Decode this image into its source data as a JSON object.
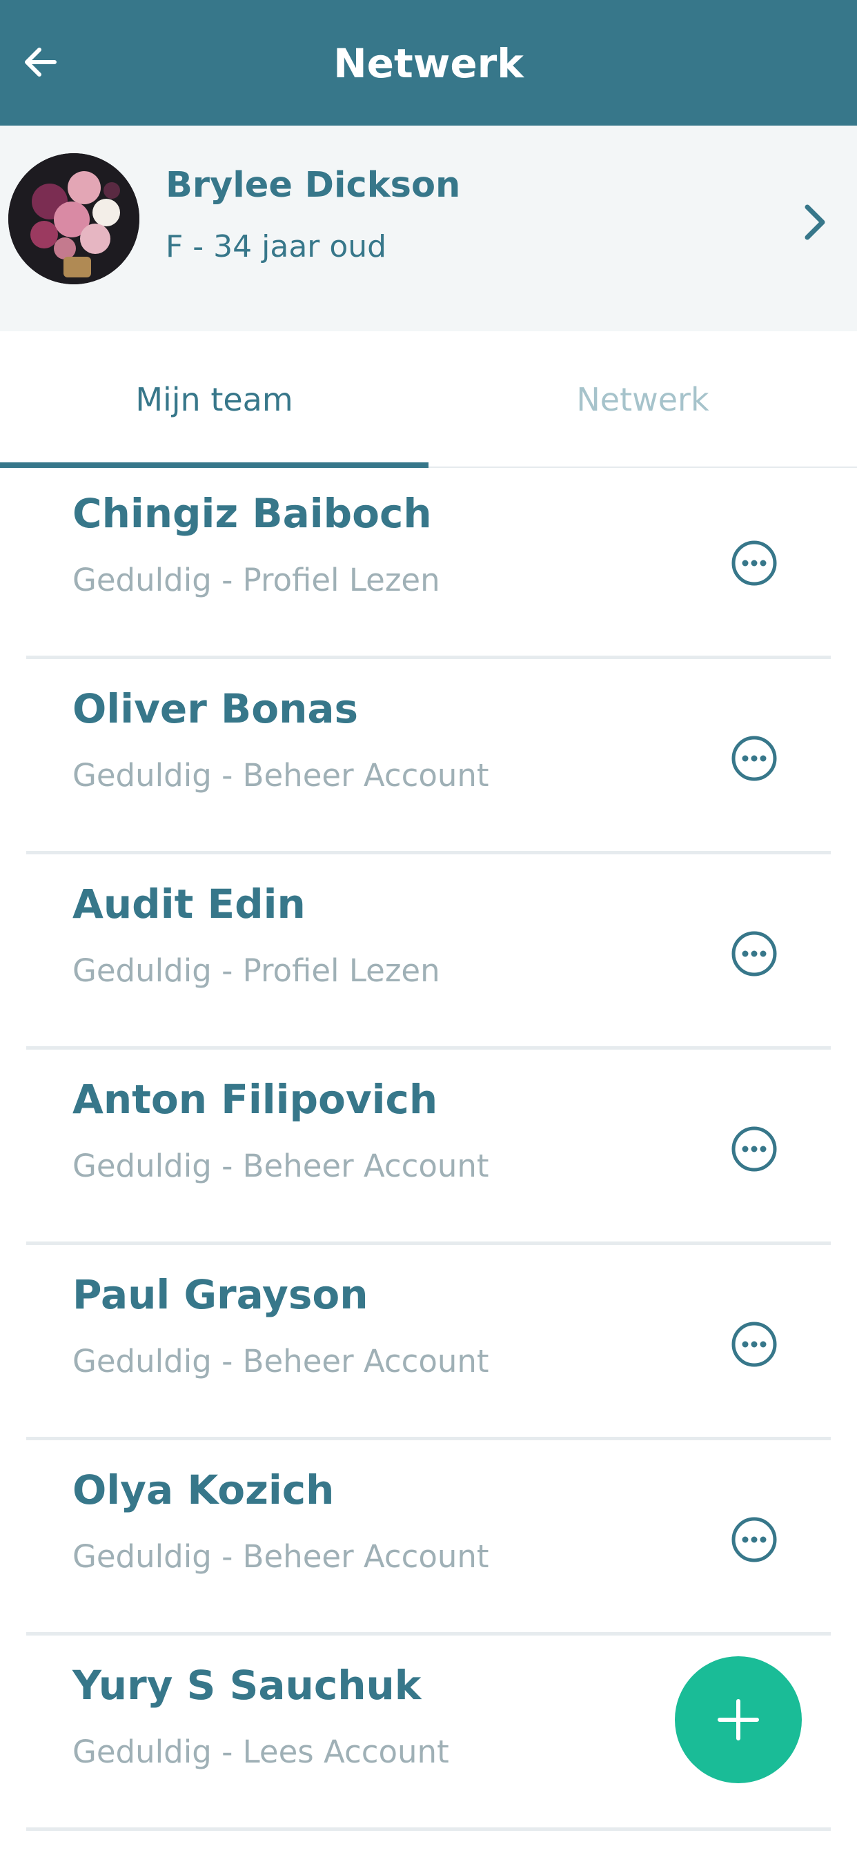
{
  "header": {
    "title": "Netwerk",
    "back_icon": "arrow-left-icon",
    "color": "#37778a"
  },
  "profile": {
    "name": "Brylee Dickson",
    "subtitle": "F - 34 jaar oud",
    "avatar": "avatar-flowers",
    "chevron_icon": "chevron-right-icon"
  },
  "tabs": [
    {
      "label": "Mijn team",
      "active": true
    },
    {
      "label": "Netwerk",
      "active": false
    }
  ],
  "team": [
    {
      "name": "Chingiz Baiboch",
      "role": "Geduldig - Profiel Lezen"
    },
    {
      "name": "Oliver Bonas",
      "role": "Geduldig - Beheer Account"
    },
    {
      "name": "Audit Edin",
      "role": "Geduldig - Profiel Lezen"
    },
    {
      "name": "Anton Filipovich",
      "role": "Geduldig - Beheer Account"
    },
    {
      "name": "Paul Grayson",
      "role": "Geduldig - Beheer Account"
    },
    {
      "name": "Olya Kozich",
      "role": "Geduldig - Beheer Account"
    },
    {
      "name": "Yury S Sauchuk",
      "role": "Geduldig - Lees Account"
    }
  ],
  "fab": {
    "icon": "plus-icon",
    "color": "#1abc97"
  },
  "colors": {
    "primary": "#37778a",
    "muted": "#9fb0b6",
    "accent": "#1abc97",
    "divider": "#e6ebee"
  }
}
